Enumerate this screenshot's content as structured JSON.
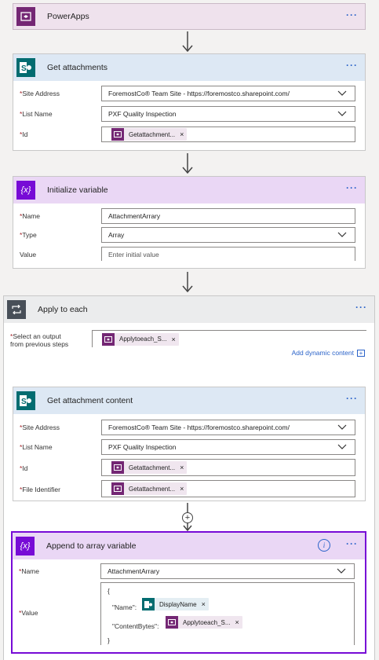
{
  "powerapps": {
    "title": "PowerApps",
    "icon": "powerapps-icon"
  },
  "get_attachments": {
    "title": "Get attachments",
    "icon": "sharepoint-icon",
    "fields": {
      "site_label": "*Site Address",
      "site_value": "ForemostCo® Team Site - https://foremostco.sharepoint.com/",
      "list_label": "*List Name",
      "list_value": "PXF Quality Inspection",
      "id_label": "*Id",
      "id_token": "Getattachment..."
    }
  },
  "init_var": {
    "title": "Initialize variable",
    "icon": "variable-icon",
    "fields": {
      "name_label": "*Name",
      "name_value": "AttachmentArrary",
      "type_label": "*Type",
      "type_value": "Array",
      "value_label": "Value",
      "value_placeholder": "Enter initial value"
    }
  },
  "apply_each": {
    "title": "Apply to each",
    "icon": "loop-icon",
    "select_label_1": "*Select an output",
    "select_label_2": "from previous steps",
    "select_token": "Applytoeach_S...",
    "add_dynamic": "Add dynamic content"
  },
  "get_content": {
    "title": "Get attachment content",
    "icon": "sharepoint-icon",
    "fields": {
      "site_label": "*Site Address",
      "site_value": "ForemostCo® Team Site - https://foremostco.sharepoint.com/",
      "list_label": "*List Name",
      "list_value": "PXF Quality Inspection",
      "id_label": "*Id",
      "id_token": "Getattachment...",
      "file_label": "*File Identifier",
      "file_token": "Getattachment..."
    }
  },
  "append": {
    "title": "Append to array variable",
    "icon": "variable-icon",
    "name_label": "*Name",
    "name_value": "AttachmentArrary",
    "value_label": "*Value",
    "line_open": "{",
    "name_key": "\"Name\":",
    "name_token": "DisplayName",
    "bytes_key": "\"ContentBytes\":",
    "bytes_token": "Applytoeach_S...",
    "line_close": "}"
  },
  "colors": {
    "powerapps": "#742774",
    "sharepoint": "#036c70",
    "variable": "#770bd6",
    "loop": "#484f58",
    "link": "#2b63c9"
  }
}
